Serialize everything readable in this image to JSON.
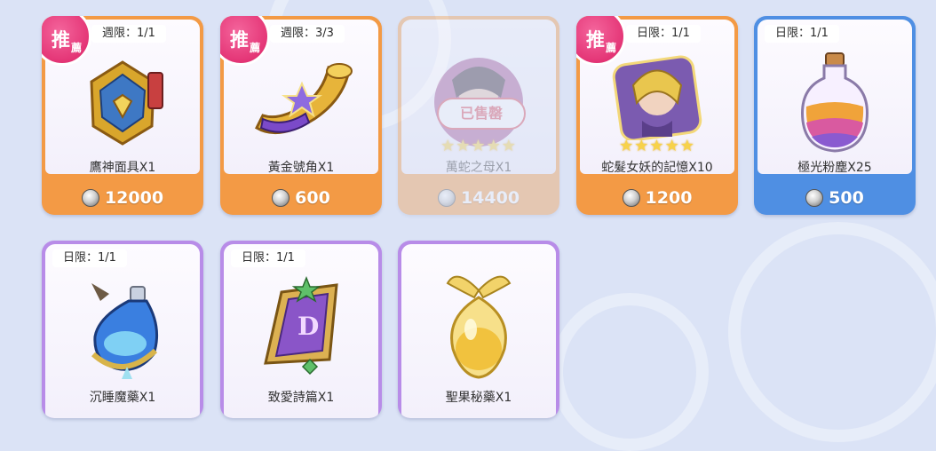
{
  "colors": {
    "card_orange": "#f39a45",
    "card_blue": "#4f8fe3",
    "card_purple": "#b88ce8",
    "badge_pink": "#e43576",
    "soldout_red": "#d94a5a"
  },
  "badge": {
    "text_main": "推",
    "text_sub": "薦"
  },
  "shop_items": [
    {
      "limit": "週限：1/1",
      "name": "鷹神面具X1",
      "price": "12000",
      "recommended": true,
      "sold_out": false,
      "icon": "eagle-god-mask-icon"
    },
    {
      "limit": "週限：3/3",
      "name": "黃金號角X1",
      "price": "600",
      "recommended": true,
      "sold_out": false,
      "icon": "golden-horn-icon"
    },
    {
      "limit": "",
      "name": "萬蛇之母X1",
      "price": "14400",
      "recommended": false,
      "sold_out": true,
      "sold_out_label": "已售罄",
      "stars": "★★★★★",
      "icon": "mother-of-snakes-portrait-icon"
    },
    {
      "limit": "日限：1/1",
      "name": "蛇髮女妖的記憶X10",
      "price": "1200",
      "recommended": true,
      "sold_out": false,
      "stars": "★★★★★",
      "icon": "medusa-memory-portrait-icon"
    },
    {
      "limit": "日限：1/1",
      "name": "極光粉塵X25",
      "price": "500",
      "recommended": false,
      "sold_out": false,
      "icon": "aurora-dust-bottle-icon"
    },
    {
      "limit": "日限：1/1",
      "name": "沉睡魔藥X1",
      "price": "",
      "recommended": false,
      "sold_out": false,
      "icon": "sleeping-potion-icon"
    },
    {
      "limit": "日限：1/1",
      "name": "致愛詩篇X1",
      "price": "",
      "recommended": false,
      "sold_out": false,
      "icon": "love-poem-scroll-icon"
    },
    {
      "limit": "",
      "name": "聖果秘藥X1",
      "price": "",
      "recommended": false,
      "sold_out": false,
      "icon": "holy-fruit-elixir-icon"
    }
  ]
}
